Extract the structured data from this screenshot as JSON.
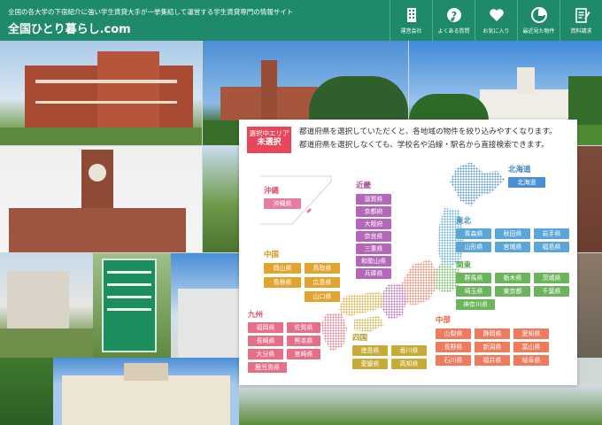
{
  "header": {
    "tagline": "全国の各大学の下宿紹介に強い学生賃貸大手が一挙集結して運営する学生賃貸専門の情報サイト",
    "site_title": "全国ひとり暮らし.com",
    "nav": [
      {
        "label": "運営会社",
        "icon": "building-icon"
      },
      {
        "label": "よくある質問",
        "icon": "question-icon"
      },
      {
        "label": "お気に入り",
        "icon": "heart-icon"
      },
      {
        "label": "最近見た物件",
        "icon": "clock-icon"
      },
      {
        "label": "資料請求",
        "icon": "document-icon"
      }
    ]
  },
  "search": {
    "selected_area_label": "選択中エリア",
    "selected_area_value": "未選択",
    "intro_line1": "都道府県を選択していただくと、各地域の物件を絞り込みやすくなります。",
    "intro_line2": "都道府県を選択しなくても、学校名や沿線・駅名から直接検索できます。"
  },
  "regions": {
    "hokkaido": {
      "title": "北海道",
      "color": "#3f7fc4",
      "prefs": [
        "北海道"
      ]
    },
    "tohoku": {
      "title": "東北",
      "color": "#3f8fc9",
      "prefs": [
        "青森県",
        "秋田県",
        "岩手県",
        "山形県",
        "宮城県",
        "福島県"
      ]
    },
    "kanto": {
      "title": "関東",
      "color": "#55a84a",
      "prefs": [
        "群馬県",
        "栃木県",
        "茨城県",
        "埼玉県",
        "東京都",
        "千葉県",
        "神奈川県"
      ]
    },
    "chubu": {
      "title": "中部",
      "color": "#e8603f",
      "prefs": [
        "山梨県",
        "静岡県",
        "愛知県",
        "長野県",
        "新潟県",
        "富山県",
        "石川県",
        "福井県",
        "岐阜県"
      ]
    },
    "kinki": {
      "title": "近畿",
      "color": "#a4509f",
      "prefs": [
        "滋賀県",
        "京都府",
        "大阪府",
        "奈良県",
        "三重県",
        "和歌山県",
        "兵庫県"
      ]
    },
    "chugoku": {
      "title": "中国",
      "color": "#d89313",
      "prefs": [
        "岡山県",
        "鳥取県",
        "島根県",
        "広島県",
        "山口県"
      ]
    },
    "shikoku": {
      "title": "四国",
      "color": "#b9961a",
      "prefs": [
        "徳島県",
        "香川県",
        "愛媛県",
        "高知県"
      ]
    },
    "kyushu": {
      "title": "九州",
      "color": "#d8546e",
      "prefs": [
        "福岡県",
        "佐賀県",
        "長崎県",
        "熊本県",
        "大分県",
        "宮崎県",
        "鹿児島県"
      ]
    },
    "okinawa": {
      "title": "沖縄",
      "color": "#d8546e",
      "prefs": [
        "沖縄県"
      ]
    }
  }
}
